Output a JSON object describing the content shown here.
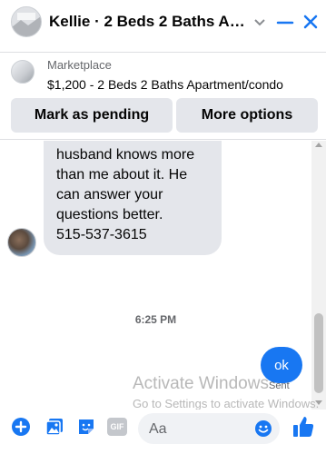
{
  "header": {
    "title": "Kellie · 2 Beds 2 Baths Apa..."
  },
  "marketplace": {
    "label": "Marketplace",
    "listing": "$1,200 - 2 Beds 2 Baths Apartment/condo",
    "mark_pending_label": "Mark as pending",
    "more_options_label": "More options"
  },
  "thread": {
    "incoming_message": "husband knows more\nthan me about it.  He\ncan answer your\nquestions better.\n515-537-3615",
    "timestamp": "6:25 PM",
    "outgoing_message": "ok",
    "status": "Sent"
  },
  "watermark": {
    "title": "Activate Windows",
    "subtitle": "Go to Settings to activate Windows."
  },
  "composer": {
    "placeholder": "Aa",
    "gif_label": "GIF"
  },
  "colors": {
    "accent": "#1877f2",
    "button_bg": "#e4e6eb",
    "secondary_text": "#65676b"
  },
  "icons": [
    "plus-circle-icon",
    "photo-icon",
    "sticker-icon",
    "gif-icon",
    "emoji-icon",
    "thumbs-up-icon",
    "chevron-down-icon",
    "minimize-icon",
    "close-icon"
  ]
}
